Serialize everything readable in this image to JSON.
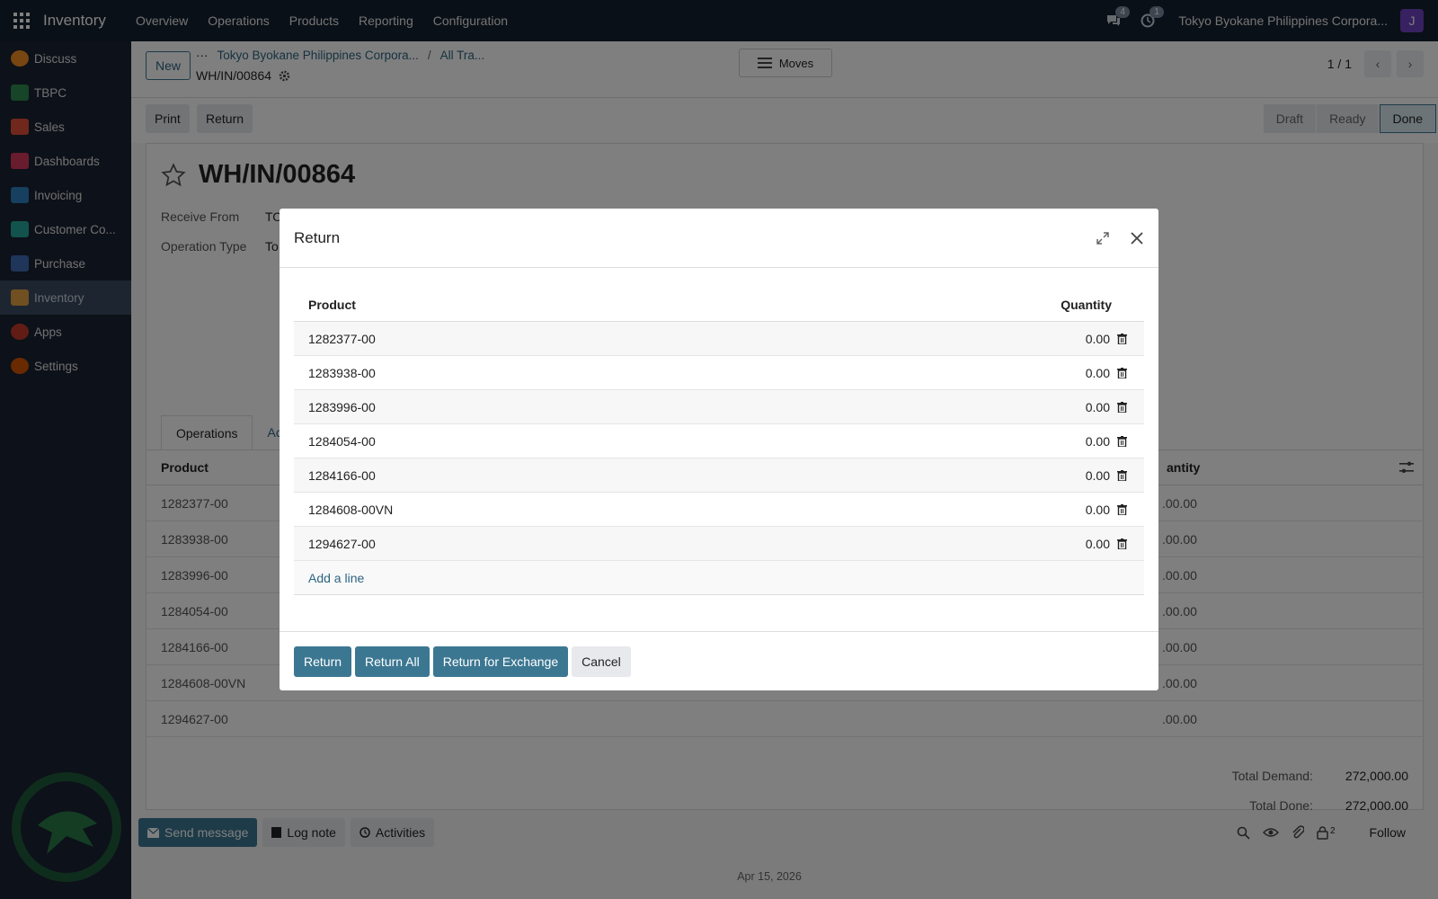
{
  "topbar": {
    "brand": "Inventory",
    "menu": [
      "Overview",
      "Operations",
      "Products",
      "Reporting",
      "Configuration"
    ],
    "messages_badge": "4",
    "activities_badge": "1",
    "company": "Tokyo Byokane Philippines Corpora...",
    "avatar": "J"
  },
  "sidebar": {
    "items": [
      {
        "label": "Discuss",
        "color": "#f08c22"
      },
      {
        "label": "TBPC",
        "color": "#2d8a4e"
      },
      {
        "label": "Sales",
        "color": "#e04e39"
      },
      {
        "label": "Dashboards",
        "color": "#d2385c"
      },
      {
        "label": "Invoicing",
        "color": "#2f7fc1"
      },
      {
        "label": "Customer Co...",
        "color": "#26a69a"
      },
      {
        "label": "Purchase",
        "color": "#3f6cb5"
      },
      {
        "label": "Inventory",
        "color": "#e0a040"
      },
      {
        "label": "Apps",
        "color": "#c0392b"
      },
      {
        "label": "Settings",
        "color": "#d35400"
      }
    ],
    "active_index": 7
  },
  "control_panel": {
    "new_label": "New",
    "breadcrumb_dots": "···",
    "breadcrumb": [
      "Tokyo Byokane Philippines Corpora...",
      "All Tra..."
    ],
    "record_name": "WH/IN/00864",
    "moves_label": "Moves",
    "pager": "1 / 1"
  },
  "status": {
    "print_label": "Print",
    "return_label": "Return",
    "stages": [
      "Draft",
      "Ready",
      "Done"
    ],
    "current_stage": "Done"
  },
  "form": {
    "title": "WH/IN/00864",
    "receive_from_label": "Receive From",
    "receive_from_value": "TO",
    "operation_type_label": "Operation Type",
    "operation_type_value": "To",
    "tabs": [
      "Operations",
      "Ac"
    ],
    "table_headers": {
      "product": "Product",
      "quantity": "antity"
    },
    "rows": [
      {
        "product": "1282377-00",
        "qty": ".00.00"
      },
      {
        "product": "1283938-00",
        "qty": ".00.00"
      },
      {
        "product": "1283996-00",
        "qty": ".00.00"
      },
      {
        "product": "1284054-00",
        "qty": ".00.00"
      },
      {
        "product": "1284166-00",
        "qty": ".00.00"
      },
      {
        "product": "1284608-00VN",
        "qty": ".00.00"
      },
      {
        "product": "1294627-00",
        "qty": ".00.00"
      }
    ],
    "total_demand_label": "Total Demand:",
    "total_demand_value": "272,000.00",
    "total_done_label": "Total Done:",
    "total_done_value": "272,000.00"
  },
  "chatter": {
    "send_message": "Send message",
    "log_note": "Log note",
    "activities": "Activities",
    "followers_count": "2",
    "follow": "Follow",
    "date": "Apr 15, 2026"
  },
  "modal": {
    "title": "Return",
    "headers": {
      "product": "Product",
      "quantity": "Quantity"
    },
    "lines": [
      {
        "product": "1282377-00",
        "qty": "0.00"
      },
      {
        "product": "1283938-00",
        "qty": "0.00"
      },
      {
        "product": "1283996-00",
        "qty": "0.00"
      },
      {
        "product": "1284054-00",
        "qty": "0.00"
      },
      {
        "product": "1284166-00",
        "qty": "0.00"
      },
      {
        "product": "1284608-00VN",
        "qty": "0.00"
      },
      {
        "product": "1294627-00",
        "qty": "0.00"
      }
    ],
    "add_line": "Add a line",
    "buttons": {
      "return": "Return",
      "return_all": "Return All",
      "return_exchange": "Return for Exchange",
      "cancel": "Cancel"
    }
  }
}
